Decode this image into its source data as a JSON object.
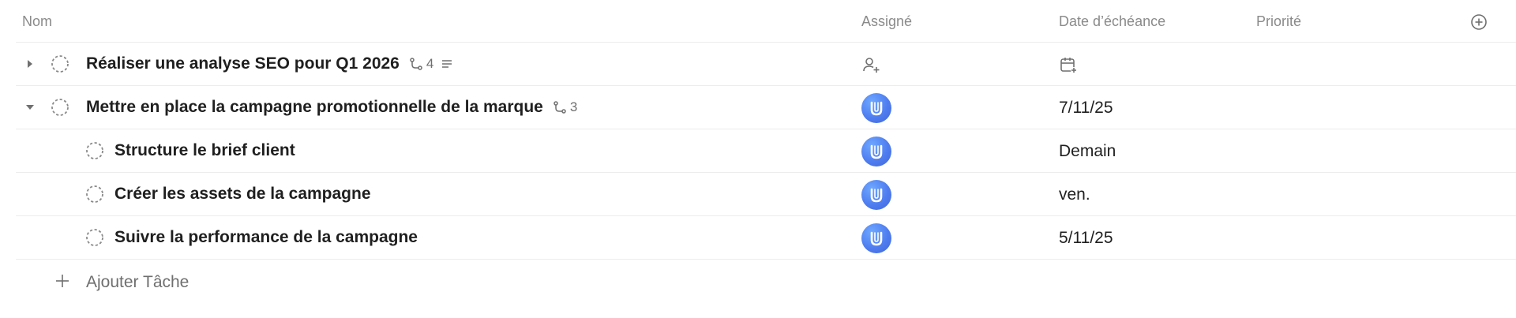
{
  "columns": {
    "name": "Nom",
    "assignee": "Assigné",
    "due_date": "Date d’échéance",
    "priority": "Priorité"
  },
  "tasks": [
    {
      "title": "Réaliser une analyse SEO pour Q1 2026",
      "subtask_count": "4",
      "has_description": true,
      "expanded": false,
      "assigned": false,
      "due_date": ""
    },
    {
      "title": "Mettre en place la campagne promotionnelle de la marque",
      "subtask_count": "3",
      "expanded": true,
      "assigned": true,
      "due_date": "7/11/25"
    },
    {
      "title": "Structure le brief client",
      "assigned": true,
      "due_date": "Demain"
    },
    {
      "title": "Créer les assets de la campagne",
      "assigned": true,
      "due_date": "ven."
    },
    {
      "title": "Suivre la performance de la campagne",
      "assigned": true,
      "due_date": "5/11/25"
    }
  ],
  "add_task_label": "Ajouter Tâche",
  "colors": {
    "border": "#ececec",
    "header_text": "#8a8a8a",
    "avatar_blue": "#4f7df0"
  }
}
